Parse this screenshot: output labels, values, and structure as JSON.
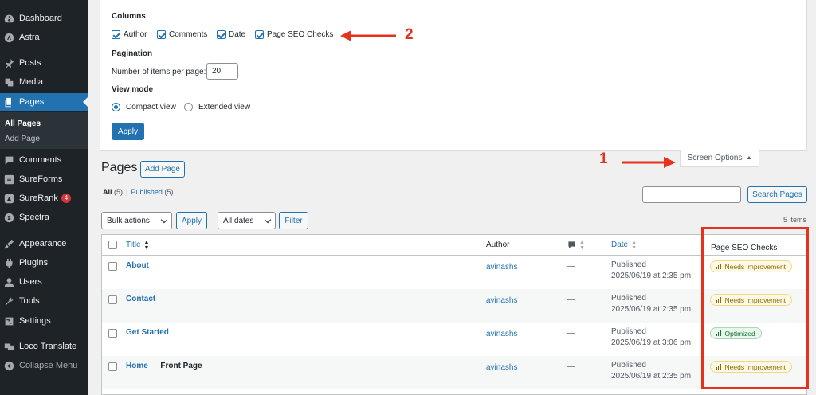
{
  "sidebar": {
    "items": [
      {
        "label": "Dashboard",
        "icon": "dashboard-icon"
      },
      {
        "label": "Astra",
        "icon": "astra-icon"
      },
      {
        "label": "Posts",
        "icon": "pin-icon"
      },
      {
        "label": "Media",
        "icon": "media-icon"
      },
      {
        "label": "Pages",
        "icon": "pages-icon",
        "active": true
      },
      {
        "label": "Comments",
        "icon": "comment-icon"
      },
      {
        "label": "SureForms",
        "icon": "sureforms-icon"
      },
      {
        "label": "SureRank",
        "icon": "surerank-icon",
        "badge": "4"
      },
      {
        "label": "Spectra",
        "icon": "spectra-icon"
      },
      {
        "label": "Appearance",
        "icon": "appearance-icon"
      },
      {
        "label": "Plugins",
        "icon": "plugins-icon"
      },
      {
        "label": "Users",
        "icon": "users-icon"
      },
      {
        "label": "Tools",
        "icon": "tools-icon"
      },
      {
        "label": "Settings",
        "icon": "settings-icon"
      },
      {
        "label": "Loco Translate",
        "icon": "translate-icon"
      },
      {
        "label": "Collapse Menu",
        "icon": "collapse-icon"
      }
    ],
    "submenu": [
      {
        "label": "All Pages",
        "current": true
      },
      {
        "label": "Add Page"
      }
    ]
  },
  "screen_options": {
    "columns_heading": "Columns",
    "columns": [
      {
        "label": "Author",
        "checked": true
      },
      {
        "label": "Comments",
        "checked": true
      },
      {
        "label": "Date",
        "checked": true
      },
      {
        "label": "Page SEO Checks",
        "checked": true
      }
    ],
    "pagination_heading": "Pagination",
    "per_page_label": "Number of items per page:",
    "per_page_value": "20",
    "view_mode_heading": "View mode",
    "view_modes": [
      {
        "label": "Compact view",
        "selected": true
      },
      {
        "label": "Extended view",
        "selected": false
      }
    ],
    "apply_label": "Apply",
    "tab_label": "Screen Options"
  },
  "annotations": {
    "arrow_1": "1",
    "arrow_2": "2",
    "color": "#e5321d"
  },
  "page": {
    "title": "Pages",
    "add_new_label": "Add Page",
    "views": [
      {
        "label": "All",
        "count": "(5)",
        "current": true
      },
      {
        "label": "Published",
        "count": "(5)"
      }
    ],
    "search_button": "Search Pages",
    "bulk_actions": "Bulk actions",
    "apply_label": "Apply",
    "dates_filter": "All dates",
    "filter_label": "Filter",
    "items_count": "5 items"
  },
  "table": {
    "headers": {
      "title": "Title",
      "author": "Author",
      "date": "Date",
      "seo": "Page SEO Checks"
    },
    "rows": [
      {
        "title": "About",
        "suffix": "",
        "author": "avinashs",
        "comments": "—",
        "status": "Published",
        "date": "2025/06/19 at 2:35 pm",
        "seo": "Needs Improvement",
        "seo_state": "warn"
      },
      {
        "title": "Contact",
        "suffix": "",
        "author": "avinashs",
        "comments": "—",
        "status": "Published",
        "date": "2025/06/19 at 2:35 pm",
        "seo": "Needs Improvement",
        "seo_state": "warn"
      },
      {
        "title": "Get Started",
        "suffix": "",
        "author": "avinashs",
        "comments": "—",
        "status": "Published",
        "date": "2025/06/19 at 3:06 pm",
        "seo": "Optimized",
        "seo_state": "ok"
      },
      {
        "title": "Home",
        "suffix": " — Front Page",
        "author": "avinashs",
        "comments": "—",
        "status": "Published",
        "date": "2025/06/19 at 2:35 pm",
        "seo": "Needs Improvement",
        "seo_state": "warn"
      }
    ]
  }
}
